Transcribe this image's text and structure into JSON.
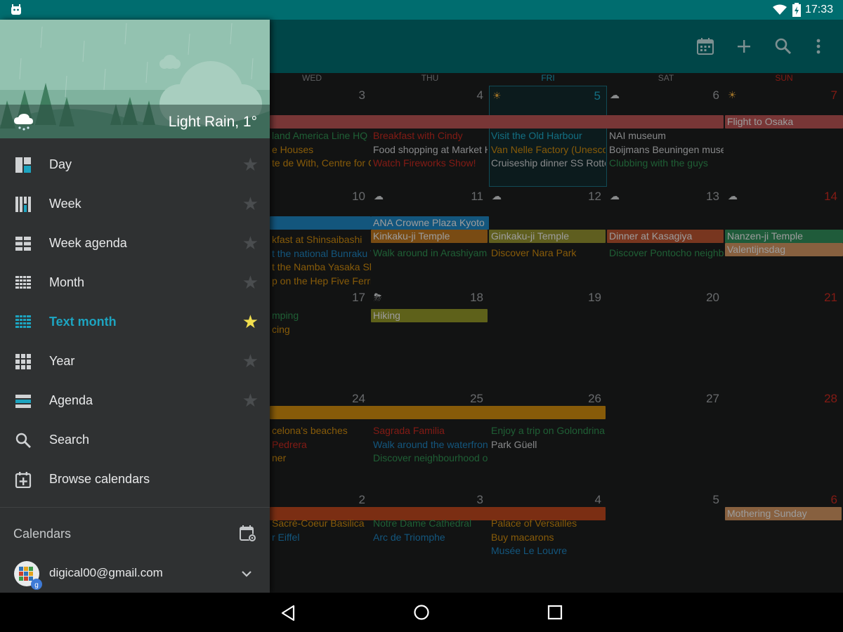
{
  "status": {
    "time": "17:33"
  },
  "appbar": {
    "icons": [
      "calendar-today-icon",
      "add-icon",
      "search-icon",
      "more-vert-icon"
    ]
  },
  "calendar": {
    "day_headers": [
      "WED",
      "THU",
      "FRI",
      "SAT",
      "SUN"
    ],
    "weeks": [
      {
        "days": [
          {
            "num": "3"
          },
          {
            "num": "4"
          },
          {
            "num": "5",
            "weather": "☀",
            "today": true
          },
          {
            "num": "6",
            "weather": "☁"
          },
          {
            "num": "7",
            "weather": "☀",
            "sunday": true
          }
        ],
        "bars": [
          {
            "text": "",
            "color": "#b25050"
          },
          {
            "text": "Flight to Osaka",
            "color": "#b25050"
          }
        ],
        "events": [
          [
            "land America Line HQ -",
            "e Houses",
            "te de With, Centre for C"
          ],
          [
            "Breakfast with Cindy",
            "Food shopping at Market H",
            "Watch Fireworks Show!"
          ],
          [
            "Visit the Old Harbour",
            "Van Nelle Factory (Unesco",
            "Cruiseship dinner SS Rotte"
          ],
          [
            "NAI museum",
            "Boijmans Beuningen muse",
            "Clubbing with the guys"
          ]
        ]
      },
      {
        "days": [
          {
            "num": "10"
          },
          {
            "num": "11",
            "weather": "☁"
          },
          {
            "num": "12",
            "weather": "☁"
          },
          {
            "num": "13",
            "weather": "☁"
          },
          {
            "num": "14",
            "weather": "☁",
            "sunday": true
          }
        ],
        "bars": [
          {
            "text": "",
            "color": "#1d7fb8"
          },
          {
            "text": "ANA Crowne Plaza Kyoto",
            "color": "#1d7fb8"
          },
          {
            "text": "Kinkaku-ji Temple",
            "color": "#b36f1d"
          },
          {
            "text": "Ginkaku-ji Temple",
            "color": "#8d8b2f"
          },
          {
            "text": "Dinner at Kasagiya",
            "color": "#b2502e"
          },
          {
            "text": "Nanzen-ji Temple",
            "color": "#2e8756"
          },
          {
            "text": "Valentijnsdag",
            "color": "#c88e5d"
          }
        ],
        "events": [
          [
            "kfast at Shinsaibashi",
            "t the national Bunraku T",
            "t the Namba Yasaka Sh",
            "p on the Hep Five Ferris"
          ],
          [
            "Walk around in Arashiyama"
          ],
          [
            "Discover Nara Park"
          ],
          [
            "Discover Pontocho neighb"
          ]
        ]
      },
      {
        "days": [
          {
            "num": "17"
          },
          {
            "num": "18",
            "weather": "⛈"
          },
          {
            "num": "19"
          },
          {
            "num": "20"
          },
          {
            "num": "21",
            "sunday": true
          }
        ],
        "bars": [
          {
            "text": "Hiking",
            "color": "#8b8f27"
          }
        ],
        "events": [
          [
            "mping",
            "cing"
          ],
          [],
          [],
          []
        ]
      },
      {
        "days": [
          {
            "num": "24"
          },
          {
            "num": "25"
          },
          {
            "num": "26"
          },
          {
            "num": "27"
          },
          {
            "num": "28",
            "sunday": true
          }
        ],
        "bars": [
          {
            "text": "",
            "color": "#c7860e"
          }
        ],
        "events": [
          [
            "celona's beaches",
            "Pedrera",
            "ner"
          ],
          [
            "Sagrada Familia",
            "Walk around the waterfron",
            "Discover neighbourhood o"
          ],
          [
            "Enjoy a trip on Golondrina",
            "Park Güell"
          ],
          []
        ]
      },
      {
        "days": [
          {
            "num": "2"
          },
          {
            "num": "3"
          },
          {
            "num": "4"
          },
          {
            "num": "5"
          },
          {
            "num": "6",
            "sunday": true
          }
        ],
        "bars": [
          {
            "text": "",
            "color": "#b5441d"
          },
          {
            "text": "Mothering Sunday",
            "color": "#c88e5d"
          }
        ],
        "events": [
          [
            "Sacré-Coeur Basilica",
            "r Eiffel"
          ],
          [
            "Notre Dame Cathedral",
            "Arc de Triomphe"
          ],
          [
            "Palace of Versailles",
            "Buy macarons",
            "Musée Le Louvre"
          ],
          []
        ]
      }
    ]
  },
  "drawer": {
    "weather": "Light Rain, 1°",
    "menu": [
      {
        "label": "Day",
        "icon": "day-view-icon",
        "starred": false
      },
      {
        "label": "Week",
        "icon": "week-view-icon",
        "starred": false
      },
      {
        "label": "Week agenda",
        "icon": "week-agenda-icon",
        "starred": false
      },
      {
        "label": "Month",
        "icon": "month-view-icon",
        "starred": false
      },
      {
        "label": "Text month",
        "icon": "text-month-icon",
        "starred": true,
        "active": true
      },
      {
        "label": "Year",
        "icon": "year-view-icon",
        "starred": false
      },
      {
        "label": "Agenda",
        "icon": "agenda-icon",
        "starred": false
      },
      {
        "label": "Search",
        "icon": "search-icon"
      },
      {
        "label": "Browse calendars",
        "icon": "browse-calendars-icon"
      }
    ],
    "calendars_label": "Calendars",
    "account": "digical00@gmail.com"
  },
  "colors": {
    "accent": "#1da4c0",
    "statusbar": "#006d6f",
    "appbar": "#00686b",
    "drawer": "#2f3132",
    "sunday": "#c0281e"
  }
}
